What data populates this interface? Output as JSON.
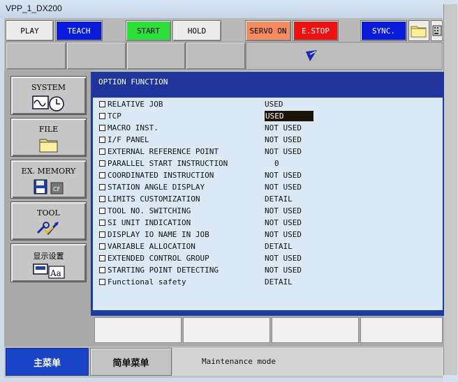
{
  "window": {
    "title": "VPP_1_DX200"
  },
  "toolbar": {
    "play": "PLAY",
    "teach": "TEACH",
    "start": "START",
    "hold": "HOLD",
    "servo_on": "SERVO ON",
    "estop": "E.STOP",
    "sync": "SYNC."
  },
  "menu": {
    "system": "SYSTEM",
    "file": "FILE",
    "ex_memory": "EX. MEMORY",
    "tool": "TOOL",
    "display_setup": "显示设置"
  },
  "panel": {
    "title": "OPTION FUNCTION",
    "items": [
      {
        "label": "RELATIVE JOB",
        "value": "USED"
      },
      {
        "label": "TCP",
        "value": "USED"
      },
      {
        "label": "MACRO INST.",
        "value": "NOT USED"
      },
      {
        "label": "I/F PANEL",
        "value": "NOT USED"
      },
      {
        "label": "EXTERNAL REFERENCE POINT",
        "value": "NOT USED"
      },
      {
        "label": "PARALLEL START INSTRUCTION",
        "value": "0"
      },
      {
        "label": "COORDINATED INSTRUCTION",
        "value": "NOT USED"
      },
      {
        "label": "STATION ANGLE DISPLAY",
        "value": "NOT USED"
      },
      {
        "label": "LIMITS CUSTOMIZATION",
        "value": "DETAIL"
      },
      {
        "label": "TOOL NO. SWITCHING",
        "value": "NOT USED"
      },
      {
        "label": "SI UNIT INDICATION",
        "value": "NOT USED"
      },
      {
        "label": "DISPLAY IO NAME IN JOB",
        "value": "NOT USED"
      },
      {
        "label": "VARIABLE ALLOCATION",
        "value": "DETAIL"
      },
      {
        "label": "EXTENDED CONTROL GROUP",
        "value": "NOT USED"
      },
      {
        "label": "STARTING POINT DETECTING",
        "value": "NOT USED"
      },
      {
        "label": "Functional safety",
        "value": "DETAIL"
      }
    ]
  },
  "bottom": {
    "main_menu": "主菜单",
    "simple_menu": "简单菜单",
    "message": "Maintenance mode"
  },
  "colors": {
    "teach": "#0a1bd9",
    "start": "#2ce03a",
    "servo_on": "#f58a5e",
    "estop": "#ee1111",
    "sync": "#0a1bd9",
    "header": "#20349b",
    "list_bg": "#dbe8f5",
    "main_menu": "#1a44c7",
    "selected_value": "#1d1206"
  },
  "icons": [
    "folder-icon",
    "keyboard-icon",
    "teach-mode-icon",
    "waveform-clock-icon",
    "file-folder-icon",
    "floppy-icon",
    "cf-card-icon",
    "tool-icon",
    "display-aa-icon"
  ]
}
